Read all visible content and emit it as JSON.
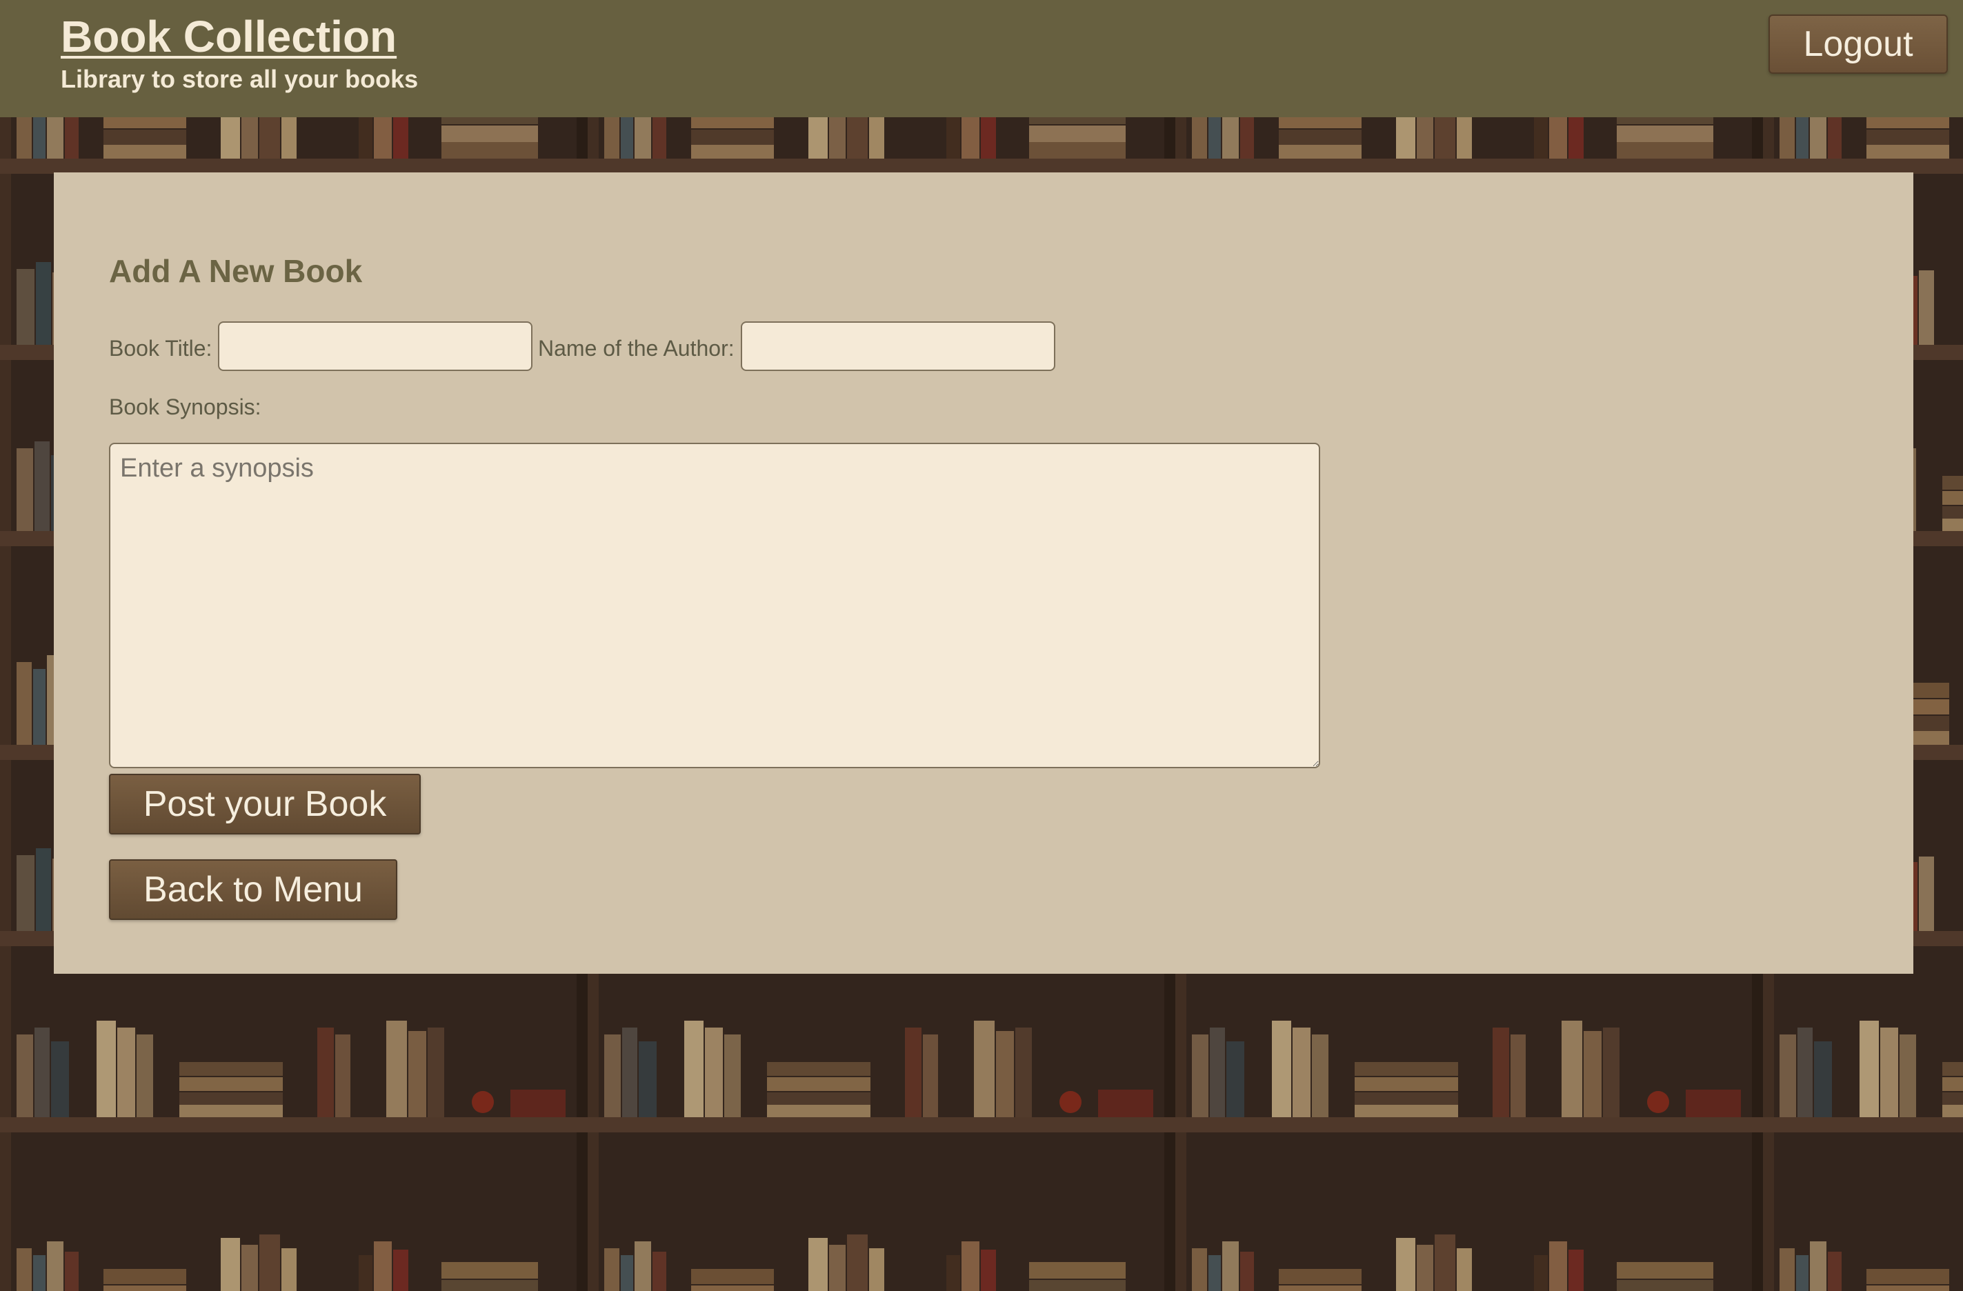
{
  "header": {
    "title": "Book Collection",
    "subtitle": "Library to store all your books",
    "logout_label": "Logout"
  },
  "form": {
    "heading": "Add A New Book",
    "title_label": "Book Title:",
    "title_value": "",
    "author_label": "Name of the Author:",
    "author_value": "",
    "synopsis_label": "Book Synopsis:",
    "synopsis_placeholder": "Enter a synopsis",
    "post_button": "Post your Book",
    "back_button": "Back to Menu"
  },
  "colors": {
    "header_bg": "#676040",
    "panel_bg": "#d1c3ab",
    "input_bg": "#f5ead7",
    "button_bg": "#6c5339",
    "heading_text": "#6b6444"
  },
  "background": "bookshelf-wallpaper"
}
